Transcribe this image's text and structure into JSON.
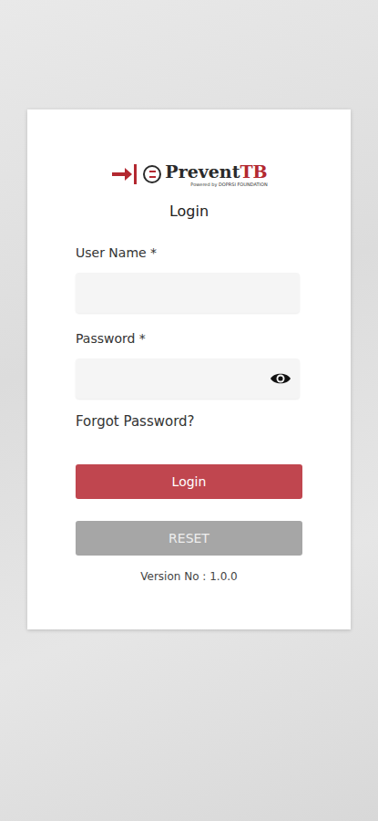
{
  "logo": {
    "title": "Prevent",
    "title_accent": "TB",
    "subtitle": "Powered by DOPRSI FOUNDATION"
  },
  "heading": "Login",
  "fields": [
    {
      "label": "User Name *",
      "value": "",
      "kind": "text"
    },
    {
      "label": "Password *",
      "value": "",
      "kind": "password"
    }
  ],
  "forgot_password": "Forgot Password?",
  "buttons": [
    {
      "label": "Login",
      "disabled": false
    },
    {
      "label": "RESET",
      "disabled": true
    }
  ],
  "version": "Version No : 1.0.0"
}
